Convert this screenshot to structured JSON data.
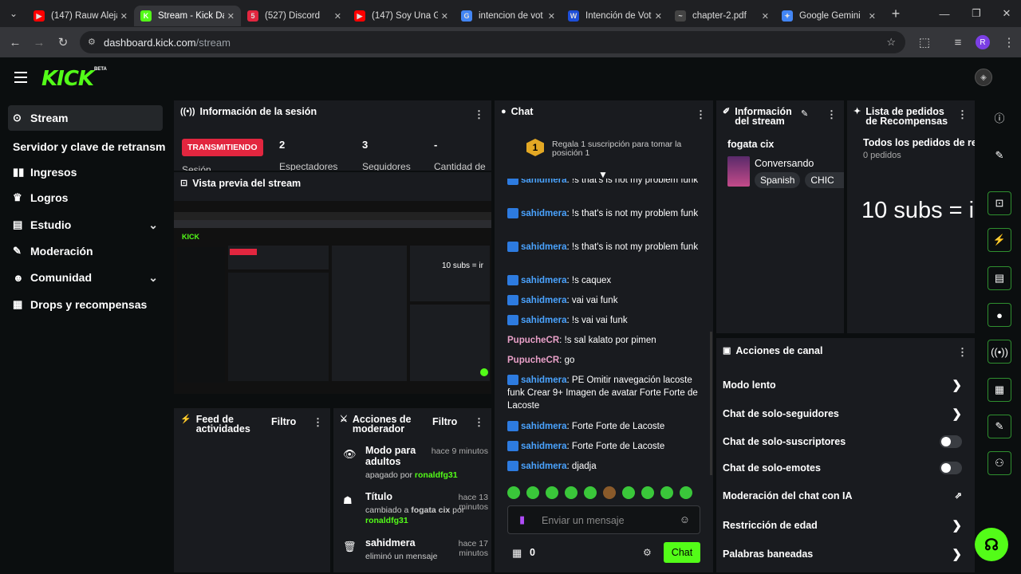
{
  "browser": {
    "tabs": [
      {
        "title": "(147) Rauw Aleja",
        "fav": "▶",
        "color": "#ff0000",
        "active": false
      },
      {
        "title": "Stream - Kick Da",
        "fav": "K",
        "color": "#53fc18",
        "active": true
      },
      {
        "title": "(527) Discord",
        "fav": "5",
        "color": "#e2263f",
        "active": false
      },
      {
        "title": "(147) Soy Una G",
        "fav": "▶",
        "color": "#ff0000",
        "active": false
      },
      {
        "title": "intencion de vot",
        "fav": "G",
        "color": "#4285f4",
        "active": false
      },
      {
        "title": "Intención de Vot",
        "fav": "W",
        "color": "#1d4ed8",
        "active": false
      },
      {
        "title": "chapter-2.pdf",
        "fav": "~",
        "color": "#444",
        "active": false
      },
      {
        "title": "Google Gemini",
        "fav": "✦",
        "color": "#4285f4",
        "active": false
      }
    ],
    "url_domain": "dashboard.kick.com",
    "url_path": "/stream",
    "profile_initial": "R"
  },
  "brand": {
    "logo": "KICK",
    "beta": "BETA"
  },
  "sidebar": {
    "items": [
      {
        "label": "Stream",
        "icon": "((•))",
        "active": true,
        "chevron": false
      },
      {
        "label": "Servidor y clave de retransm",
        "icon": "",
        "active": false,
        "chevron": false
      },
      {
        "label": "Ingresos",
        "icon": "▮▮",
        "active": false,
        "chevron": false
      },
      {
        "label": "Logros",
        "icon": "♛",
        "active": false,
        "chevron": false
      },
      {
        "label": "Estudio",
        "icon": "▤",
        "active": false,
        "chevron": true
      },
      {
        "label": "Moderación",
        "icon": "✎",
        "active": false,
        "chevron": false
      },
      {
        "label": "Comunidad",
        "icon": "☻",
        "active": false,
        "chevron": true
      },
      {
        "label": "Drops y recompensas",
        "icon": "▦",
        "active": false,
        "chevron": false
      }
    ]
  },
  "session": {
    "title": "Información de la sesión",
    "live_label": "TRANSMITIENDO",
    "session_label": "Sesión",
    "stats": [
      {
        "value": "2",
        "label": "Espectadores"
      },
      {
        "value": "3",
        "label": "Seguidores"
      },
      {
        "value": "-",
        "label": "Cantidad de"
      }
    ]
  },
  "preview": {
    "title": "Vista previa del stream",
    "overlay_text": "10 subs = ir"
  },
  "activity": {
    "title_line1": "Feed de",
    "title_line2": "actividades",
    "filter": "Filtro"
  },
  "mod_actions": {
    "title_line1": "Acciones de",
    "title_line2": "moderador",
    "filter": "Filtro",
    "items": [
      {
        "icon": "👁",
        "title": "Modo para adultos",
        "time": "hace 9 minutos",
        "desc": "apagado por",
        "user": "ronaldfg31"
      },
      {
        "icon": "☗",
        "title": "Título",
        "time": "hace 13 minutos",
        "desc": "cambiado a",
        "bold": "fogata cix",
        "desc2": "por",
        "user": "ronaldfg31"
      },
      {
        "icon": "🗑",
        "title": "sahidmera",
        "time": "hace 17 minutos",
        "desc": "eliminó un mensaje",
        "user": ""
      }
    ]
  },
  "chat": {
    "title": "Chat",
    "promo": "Regala 1 suscripción para tomar la posición 1",
    "promo_rank": "1",
    "messages": [
      {
        "user": "sahidmera",
        "color": "blue",
        "text": "!s that's is not my problem funk",
        "badge": true
      },
      {
        "user": "sahidmera",
        "color": "blue",
        "text": "!s that's is not my problem funk",
        "badge": true
      },
      {
        "user": "sahidmera",
        "color": "blue",
        "text": "!s that's is not my problem funk",
        "badge": true
      },
      {
        "user": "sahidmera",
        "color": "blue",
        "text": "!s caquex",
        "badge": true
      },
      {
        "user": "sahidmera",
        "color": "blue",
        "text": "vai vai funk",
        "badge": true
      },
      {
        "user": "sahidmera",
        "color": "blue",
        "text": "!s vai vai funk",
        "badge": true
      },
      {
        "user": "PupucheCR",
        "color": "pink",
        "text": "!s sal kalato por pimen",
        "badge": false
      },
      {
        "user": "PupucheCR",
        "color": "pink",
        "text": "go",
        "badge": false
      },
      {
        "user": "sahidmera",
        "color": "blue",
        "text": "PE Omitir navegación lacoste funk Crear 9+ Imagen de avatar Forte Forte de Lacoste",
        "badge": true
      },
      {
        "user": "sahidmera",
        "color": "blue",
        "text": "Forte Forte de Lacoste",
        "badge": true
      },
      {
        "user": "sahidmera",
        "color": "blue",
        "text": "Forte Forte de Lacoste",
        "badge": true
      },
      {
        "user": "sahidmera",
        "color": "blue",
        "text": "djadja",
        "badge": true
      }
    ],
    "input_placeholder": "Enviar un mensaje",
    "points": "0",
    "send_label": "Chat"
  },
  "stream_info": {
    "title_line1": "Información",
    "title_line2": "del stream",
    "stream_title": "fogata cix",
    "category": "Conversando",
    "tags": [
      "Spanish",
      "CHIC"
    ]
  },
  "rewards": {
    "title_line1": "Lista de pedidos",
    "title_line2": "de Recompensas",
    "all_label": "Todos los pedidos de rec",
    "count": "0 pedidos"
  },
  "channel_actions": {
    "title": "Acciones de canal",
    "rows": [
      {
        "label": "Modo lento",
        "type": "arrow"
      },
      {
        "label": "Chat de solo-seguidores",
        "type": "arrow"
      },
      {
        "label": "Chat de solo-suscriptores",
        "type": "toggle"
      },
      {
        "label": "Chat de solo-emotes",
        "type": "toggle"
      },
      {
        "label": "Moderación del chat con IA",
        "type": "external"
      },
      {
        "label": "Restricción de edad",
        "type": "arrow"
      },
      {
        "label": "Palabras baneadas",
        "type": "arrow"
      }
    ]
  },
  "colors": {
    "accent": "#53fc18",
    "live": "#e2263f",
    "panel": "#191b1f"
  }
}
